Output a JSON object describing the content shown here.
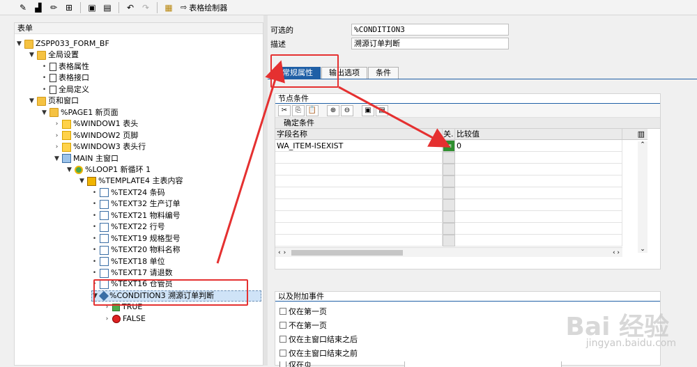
{
  "toolbar": {
    "buttons": [
      "pencil-glasses-icon",
      "bucket-icon",
      "pencil-icon",
      "stamp-icon",
      "frame-icon",
      "save-frame-icon",
      "undo-icon",
      "redo-icon",
      "form-icon"
    ],
    "painter_label": "表格绘制器"
  },
  "tree": {
    "header": "表单",
    "nodes": [
      {
        "label": "ZSPP033_FORM_BF",
        "icon": "folder-icon",
        "level": 0,
        "twisty": "▼"
      },
      {
        "label": "全局设置",
        "icon": "folder-icon",
        "level": 1,
        "twisty": "▼"
      },
      {
        "label": "表格属性",
        "icon": "document-icon",
        "level": 2,
        "twisty": "•"
      },
      {
        "label": "表格接口",
        "icon": "document-icon",
        "level": 2,
        "twisty": "•"
      },
      {
        "label": "全局定义",
        "icon": "document-icon",
        "level": 2,
        "twisty": "•"
      },
      {
        "label": "页和窗口",
        "icon": "folder-icon",
        "level": 1,
        "twisty": "▼"
      },
      {
        "label": "%PAGE1 新页面",
        "icon": "folder-icon",
        "level": 2,
        "twisty": "▼"
      },
      {
        "label": "%WINDOW1 表头",
        "icon": "window-icon",
        "level": 3,
        "twisty": "›"
      },
      {
        "label": "%WINDOW2 页脚",
        "icon": "window-icon",
        "level": 3,
        "twisty": "›"
      },
      {
        "label": "%WINDOW3 表头行",
        "icon": "window-icon",
        "level": 3,
        "twisty": "›"
      },
      {
        "label": "MAIN 主窗口",
        "icon": "main-window-icon",
        "level": 3,
        "twisty": "▼"
      },
      {
        "label": "%LOOP1 新循环 1",
        "icon": "loop-icon",
        "level": 4,
        "twisty": "▼"
      },
      {
        "label": "%TEMPLATE4 主表内容",
        "icon": "template-icon",
        "level": 5,
        "twisty": "▼"
      },
      {
        "label": "%TEXT24 条码",
        "icon": "text-icon",
        "level": 6,
        "twisty": "•"
      },
      {
        "label": "%TEXT32 生产订单",
        "icon": "text-icon",
        "level": 6,
        "twisty": "•"
      },
      {
        "label": "%TEXT21 物料编号",
        "icon": "text-icon",
        "level": 6,
        "twisty": "•"
      },
      {
        "label": "%TEXT22 行号",
        "icon": "text-icon",
        "level": 6,
        "twisty": "•"
      },
      {
        "label": "%TEXT19 规格型号",
        "icon": "text-icon",
        "level": 6,
        "twisty": "•"
      },
      {
        "label": "%TEXT20 物料名称",
        "icon": "text-icon",
        "level": 6,
        "twisty": "•"
      },
      {
        "label": "%TEXT18 单位",
        "icon": "text-icon",
        "level": 6,
        "twisty": "•"
      },
      {
        "label": "%TEXT17 请退数",
        "icon": "text-icon",
        "level": 6,
        "twisty": "•"
      },
      {
        "label": "%TEXT16 仓管员",
        "icon": "text-icon",
        "level": 6,
        "twisty": "•"
      },
      {
        "label": "%CONDITION3 溯源订单判断",
        "icon": "condition-icon",
        "level": 6,
        "twisty": "▼",
        "selected": true
      },
      {
        "label": "TRUE",
        "icon": "true-icon",
        "level": 7,
        "twisty": "›"
      },
      {
        "label": "FALSE",
        "icon": "false-icon",
        "level": 7,
        "twisty": "›"
      }
    ]
  },
  "header_fields": {
    "optional_label": "可选的",
    "optional_value": "%CONDITION3",
    "desc_label": "描述",
    "desc_value": "溯源订单判断"
  },
  "tabs": [
    "常规属性",
    "输出选项",
    "条件"
  ],
  "node_conditions": {
    "title": "节点条件",
    "grid_title": "确定条件",
    "columns": [
      "字段名称",
      "关.",
      "比较值"
    ],
    "rows": [
      {
        "field": "WA_ITEM-ISEXIST",
        "op": "=",
        "value": "0"
      }
    ]
  },
  "events": {
    "title": "以及附加事件",
    "options": [
      "仅在第一页",
      "不在第一页",
      "仅在主窗口结束之后",
      "仅在主窗口结束之前",
      "仅在页"
    ]
  },
  "watermark": {
    "main": "Bai 经验",
    "sub": "jingyan.baidu.com"
  }
}
